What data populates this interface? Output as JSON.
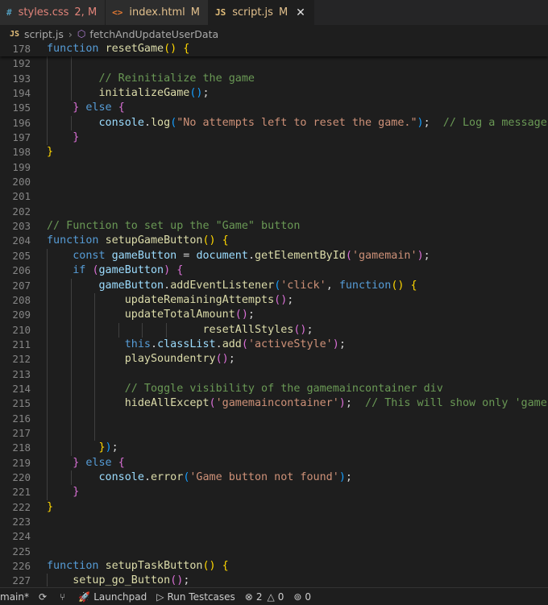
{
  "tabs": [
    {
      "icon": "#",
      "icon_color": "#519aba",
      "name": "styles.css",
      "name_color": "#e2847a",
      "status": "2, M",
      "status_color": "#e2847a",
      "active": false
    },
    {
      "icon": "<>",
      "icon_color": "#e37933",
      "name": "index.html",
      "name_color": "#e2c08d",
      "status": "M",
      "status_color": "#e2c08d",
      "active": false
    },
    {
      "icon": "JS",
      "icon_color": "#e5c07b",
      "name": "script.js",
      "name_color": "#e2c08d",
      "status": "M",
      "status_color": "#e2c08d",
      "active": true
    }
  ],
  "breadcrumb": {
    "file_icon": "JS",
    "file": "script.js",
    "symbol": "fetchAndUpdateUserData"
  },
  "code_lines": [
    {
      "n": "178",
      "sticky": true,
      "indent": 0,
      "t": [
        [
          "kw",
          "function "
        ],
        [
          "fn",
          "resetGame"
        ],
        [
          "p1",
          "() {"
        ]
      ]
    },
    {
      "n": "192",
      "indent": 2,
      "t": []
    },
    {
      "n": "193",
      "indent": 2,
      "t": [
        [
          "com",
          "        // Reinitialize the game"
        ]
      ]
    },
    {
      "n": "194",
      "indent": 2,
      "t": [
        [
          "fn",
          "        initializeGame"
        ],
        [
          "p3",
          "()"
        ],
        [
          "pn",
          ";"
        ]
      ]
    },
    {
      "n": "195",
      "indent": 1,
      "t": [
        [
          "p2",
          "    }"
        ],
        [
          "kw",
          " else "
        ],
        [
          "p2",
          "{"
        ]
      ]
    },
    {
      "n": "196",
      "indent": 2,
      "t": [
        [
          "var",
          "        console"
        ],
        [
          "pn",
          "."
        ],
        [
          "fn",
          "log"
        ],
        [
          "p3",
          "("
        ],
        [
          "str",
          "\"No attempts left to reset the game.\""
        ],
        [
          "p3",
          ")"
        ],
        [
          "pn",
          ";  "
        ],
        [
          "com",
          "// Log a message if no"
        ]
      ]
    },
    {
      "n": "197",
      "indent": 1,
      "t": [
        [
          "p2",
          "    }"
        ]
      ]
    },
    {
      "n": "198",
      "indent": 0,
      "t": [
        [
          "p1",
          "}"
        ]
      ]
    },
    {
      "n": "199",
      "indent": 0,
      "t": []
    },
    {
      "n": "200",
      "indent": 0,
      "t": []
    },
    {
      "n": "201",
      "indent": 0,
      "t": []
    },
    {
      "n": "202",
      "indent": 0,
      "t": []
    },
    {
      "n": "203",
      "indent": 0,
      "t": [
        [
          "com",
          "// Function to set up the \"Game\" button"
        ]
      ]
    },
    {
      "n": "204",
      "indent": 0,
      "t": [
        [
          "kw",
          "function "
        ],
        [
          "fn",
          "setupGameButton"
        ],
        [
          "p1",
          "() {"
        ]
      ]
    },
    {
      "n": "205",
      "indent": 1,
      "t": [
        [
          "kw",
          "    const "
        ],
        [
          "var",
          "gameButton"
        ],
        [
          "pn",
          " = "
        ],
        [
          "var",
          "document"
        ],
        [
          "pn",
          "."
        ],
        [
          "fn",
          "getElementById"
        ],
        [
          "p2",
          "("
        ],
        [
          "str",
          "'gamemain'"
        ],
        [
          "p2",
          ")"
        ],
        [
          "pn",
          ";"
        ]
      ]
    },
    {
      "n": "206",
      "indent": 1,
      "t": [
        [
          "kw",
          "    if "
        ],
        [
          "p2",
          "("
        ],
        [
          "var",
          "gameButton"
        ],
        [
          "p2",
          ") {"
        ]
      ]
    },
    {
      "n": "207",
      "indent": 2,
      "t": [
        [
          "var",
          "        gameButton"
        ],
        [
          "pn",
          "."
        ],
        [
          "fn",
          "addEventListener"
        ],
        [
          "p3",
          "("
        ],
        [
          "str",
          "'click'"
        ],
        [
          "pn",
          ", "
        ],
        [
          "kw",
          "function"
        ],
        [
          "p1",
          "() {"
        ]
      ]
    },
    {
      "n": "208",
      "indent": 3,
      "t": [
        [
          "fn",
          "            updateRemainingAttempts"
        ],
        [
          "p2",
          "()"
        ],
        [
          "pn",
          ";"
        ]
      ]
    },
    {
      "n": "209",
      "indent": 3,
      "t": [
        [
          "fn",
          "            updateTotalAmount"
        ],
        [
          "p2",
          "()"
        ],
        [
          "pn",
          ";"
        ]
      ]
    },
    {
      "n": "210",
      "indent": 6,
      "t": [
        [
          "fn",
          "                        resetAllStyles"
        ],
        [
          "p2",
          "()"
        ],
        [
          "pn",
          ";"
        ]
      ]
    },
    {
      "n": "211",
      "indent": 3,
      "t": [
        [
          "kw",
          "            this"
        ],
        [
          "pn",
          "."
        ],
        [
          "var",
          "classList"
        ],
        [
          "pn",
          "."
        ],
        [
          "fn",
          "add"
        ],
        [
          "p2",
          "("
        ],
        [
          "str",
          "'activeStyle'"
        ],
        [
          "p2",
          ")"
        ],
        [
          "pn",
          ";"
        ]
      ]
    },
    {
      "n": "212",
      "indent": 3,
      "t": [
        [
          "fn",
          "            playSoundentry"
        ],
        [
          "p2",
          "()"
        ],
        [
          "pn",
          ";"
        ]
      ]
    },
    {
      "n": "213",
      "indent": 3,
      "t": []
    },
    {
      "n": "214",
      "indent": 3,
      "t": [
        [
          "com",
          "            // Toggle visibility of the gamemaincontainer div"
        ]
      ]
    },
    {
      "n": "215",
      "indent": 3,
      "t": [
        [
          "fn",
          "            hideAllExcept"
        ],
        [
          "p2",
          "("
        ],
        [
          "str",
          "'gamemaincontainer'"
        ],
        [
          "p2",
          ")"
        ],
        [
          "pn",
          ";  "
        ],
        [
          "com",
          "// This will show only 'gamecontain"
        ]
      ]
    },
    {
      "n": "216",
      "indent": 3,
      "t": []
    },
    {
      "n": "217",
      "indent": 3,
      "t": []
    },
    {
      "n": "218",
      "indent": 2,
      "t": [
        [
          "p1",
          "        }"
        ],
        [
          "p3",
          ")"
        ],
        [
          "pn",
          ";"
        ]
      ]
    },
    {
      "n": "219",
      "indent": 1,
      "t": [
        [
          "p2",
          "    }"
        ],
        [
          "kw",
          " else "
        ],
        [
          "p2",
          "{"
        ]
      ]
    },
    {
      "n": "220",
      "indent": 2,
      "t": [
        [
          "var",
          "        console"
        ],
        [
          "pn",
          "."
        ],
        [
          "fn",
          "error"
        ],
        [
          "p3",
          "("
        ],
        [
          "str",
          "'Game button not found'"
        ],
        [
          "p3",
          ")"
        ],
        [
          "pn",
          ";"
        ]
      ]
    },
    {
      "n": "221",
      "indent": 1,
      "t": [
        [
          "p2",
          "    }"
        ]
      ]
    },
    {
      "n": "222",
      "indent": 0,
      "t": [
        [
          "p1",
          "}"
        ]
      ]
    },
    {
      "n": "223",
      "indent": 0,
      "t": []
    },
    {
      "n": "224",
      "indent": 0,
      "t": []
    },
    {
      "n": "225",
      "indent": 0,
      "t": []
    },
    {
      "n": "226",
      "indent": 0,
      "t": [
        [
          "kw",
          "function "
        ],
        [
          "fn",
          "setupTaskButton"
        ],
        [
          "p1",
          "() {"
        ]
      ]
    },
    {
      "n": "227",
      "indent": 1,
      "t": [
        [
          "fn",
          "    setup_go_Button"
        ],
        [
          "p2",
          "()"
        ],
        [
          "pn",
          ";"
        ]
      ]
    }
  ],
  "status": {
    "branch_icon": "git-branch-icon",
    "branch": "main*",
    "sync_icon": "sync-icon",
    "launchpad": "Launchpad",
    "run_testcases": "Run Testcases",
    "errors": "2",
    "warnings": "0",
    "ports": "0"
  }
}
